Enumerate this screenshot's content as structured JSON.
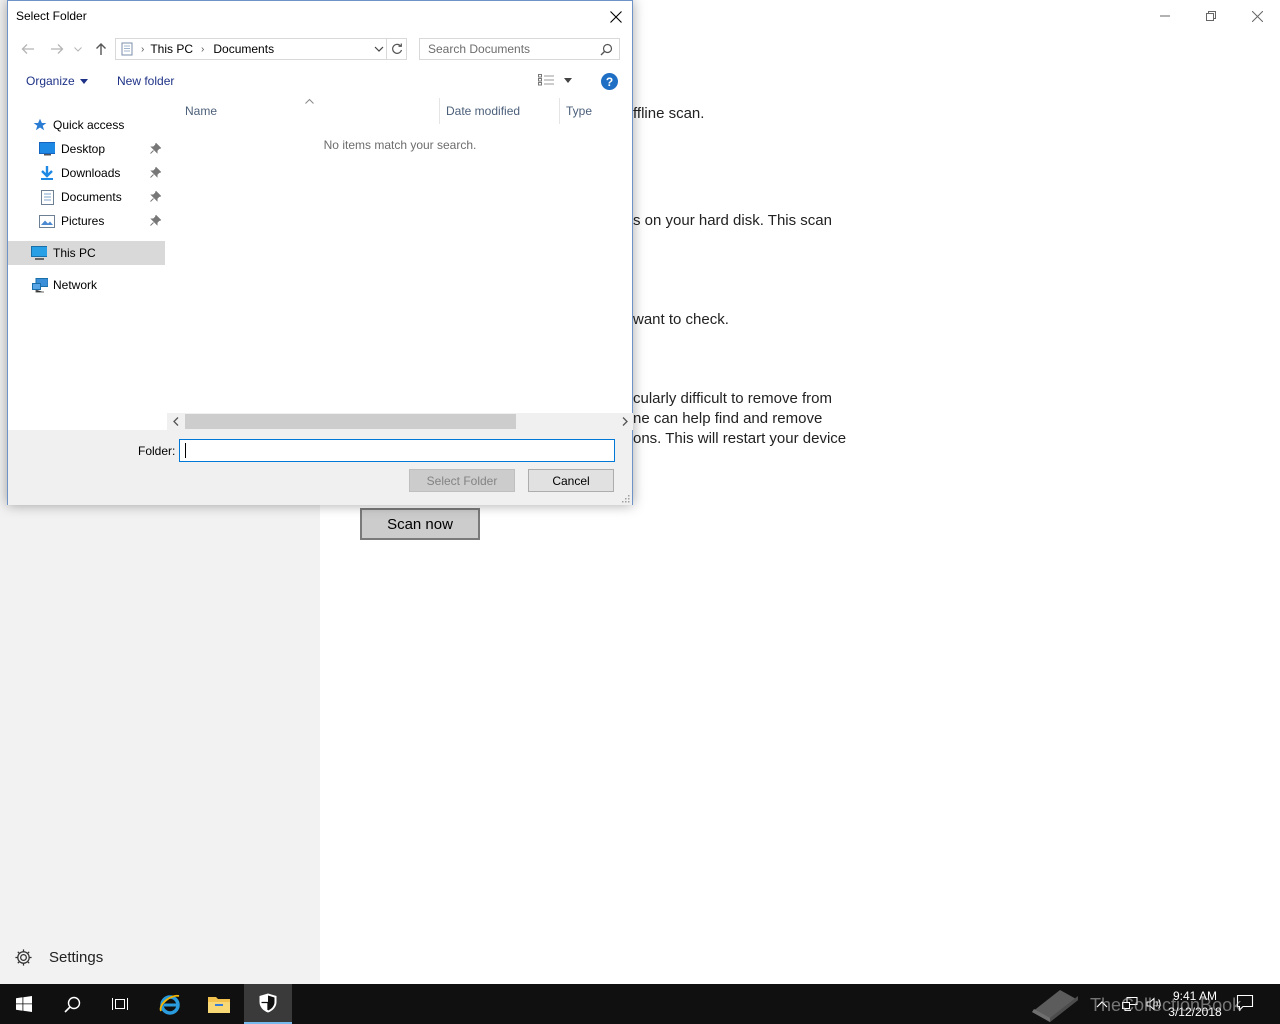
{
  "background": {
    "lines": [
      "ffline scan.",
      "s on your hard disk. This scan",
      "want to check.",
      "cularly difficult to remove from",
      "ne can help find and remove",
      "ons. This will restart your device"
    ],
    "scan_button": "Scan now",
    "settings_label": "Settings"
  },
  "dialog": {
    "title": "Select Folder",
    "address": {
      "crumbs": [
        "This PC",
        "Documents"
      ]
    },
    "search_placeholder": "Search Documents",
    "toolbar": {
      "organize": "Organize",
      "new_folder": "New folder",
      "help": "?"
    },
    "nav_tree": {
      "quick_access": "Quick access",
      "desktop": "Desktop",
      "downloads": "Downloads",
      "documents": "Documents",
      "pictures": "Pictures",
      "this_pc": "This PC",
      "network": "Network"
    },
    "columns": [
      "Name",
      "Date modified",
      "Type"
    ],
    "empty_message": "No items match your search.",
    "folder_label": "Folder:",
    "folder_value": "",
    "select_button": "Select Folder",
    "cancel_button": "Cancel"
  },
  "taskbar": {
    "time": "9:41 AM",
    "date": "3/12/2018",
    "watermark": "TheCollectionBook"
  },
  "colors": {
    "accent": "#0078d7",
    "help": "#1f6fc5",
    "taskbar": "#101010",
    "sidebar": "#f2f2f2"
  }
}
